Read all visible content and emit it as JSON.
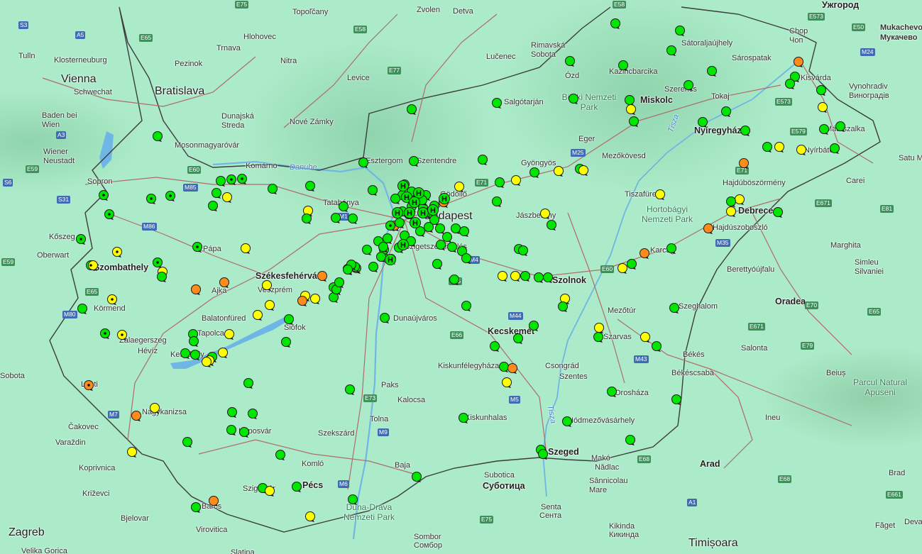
{
  "map": {
    "colors": {
      "green": "#00e600",
      "yellow": "#ffff00",
      "orange": "#ff8c1a",
      "outline": "#1a1a1a",
      "road": "#b06b6b",
      "border": "#4a4a4a",
      "water": "#6fb6e6"
    },
    "places": [
      {
        "name": "Vienna",
        "cls": "big"
      },
      {
        "name": "Bratislava",
        "cls": "big"
      },
      {
        "name": "Zagreb",
        "cls": "big"
      },
      {
        "name": "Timișoara",
        "cls": "big"
      },
      {
        "name": "Tulln",
        "cls": ""
      },
      {
        "name": "Klosterneuburg",
        "cls": ""
      },
      {
        "name": "Schwechat",
        "cls": ""
      },
      {
        "name": "Baden bei Wien",
        "cls": ""
      },
      {
        "name": "Wiener Neustadt",
        "cls": ""
      },
      {
        "name": "Oberwart",
        "cls": ""
      },
      {
        "name": "Kőszeg",
        "cls": ""
      },
      {
        "name": "Sopron",
        "cls": ""
      },
      {
        "name": "Sobota",
        "cls": ""
      },
      {
        "name": "Čakovec",
        "cls": ""
      },
      {
        "name": "Varaždin",
        "cls": ""
      },
      {
        "name": "Koprivnica",
        "cls": ""
      },
      {
        "name": "Križevci",
        "cls": ""
      },
      {
        "name": "Bjelovar",
        "cls": ""
      },
      {
        "name": "Virovitica",
        "cls": ""
      },
      {
        "name": "Velika Gorica",
        "cls": ""
      },
      {
        "name": "Pezinok",
        "cls": ""
      },
      {
        "name": "Trnava",
        "cls": ""
      },
      {
        "name": "Hlohovec",
        "cls": ""
      },
      {
        "name": "Topoľčany",
        "cls": ""
      },
      {
        "name": "Zvolen",
        "cls": ""
      },
      {
        "name": "Detva",
        "cls": ""
      },
      {
        "name": "Nitra",
        "cls": ""
      },
      {
        "name": "Levice",
        "cls": ""
      },
      {
        "name": "Lučenec",
        "cls": ""
      },
      {
        "name": "Rimavská Sobota",
        "cls": ""
      },
      {
        "name": "Dunajská Streda",
        "cls": ""
      },
      {
        "name": "Nové Zámky",
        "cls": ""
      },
      {
        "name": "Komárno",
        "cls": ""
      },
      {
        "name": "Mosonmagyaróvár",
        "cls": ""
      },
      {
        "name": "Tatabánya",
        "cls": ""
      },
      {
        "name": "Esztergom",
        "cls": ""
      },
      {
        "name": "Szentendre",
        "cls": ""
      },
      {
        "name": "Gödöllő",
        "cls": ""
      },
      {
        "name": "Budapest",
        "cls": "big"
      },
      {
        "name": "Szigetszentmiklós",
        "cls": ""
      },
      {
        "name": "Pápa",
        "cls": ""
      },
      {
        "name": "Szombathely",
        "cls": "mid"
      },
      {
        "name": "Ajka",
        "cls": ""
      },
      {
        "name": "Veszprém",
        "cls": ""
      },
      {
        "name": "Székesfehérvár",
        "cls": "mid"
      },
      {
        "name": "Balatonfüred",
        "cls": ""
      },
      {
        "name": "Siófok",
        "cls": ""
      },
      {
        "name": "Tapolca",
        "cls": ""
      },
      {
        "name": "Keszthely",
        "cls": ""
      },
      {
        "name": "Hévíz",
        "cls": ""
      },
      {
        "name": "Zalaegerszeg",
        "cls": ""
      },
      {
        "name": "Körmend",
        "cls": ""
      },
      {
        "name": "Lenti",
        "cls": ""
      },
      {
        "name": "Nagykanizsa",
        "cls": ""
      },
      {
        "name": "Kaposvár",
        "cls": ""
      },
      {
        "name": "Barcs",
        "cls": ""
      },
      {
        "name": "Szigetvár",
        "cls": ""
      },
      {
        "name": "Komló",
        "cls": ""
      },
      {
        "name": "Pécs",
        "cls": "mid"
      },
      {
        "name": "Dunaújváros",
        "cls": ""
      },
      {
        "name": "Paks",
        "cls": ""
      },
      {
        "name": "Kalocsa",
        "cls": ""
      },
      {
        "name": "Tolna",
        "cls": ""
      },
      {
        "name": "Szekszárd",
        "cls": ""
      },
      {
        "name": "Baja",
        "cls": ""
      },
      {
        "name": "Kiskunhalas",
        "cls": ""
      },
      {
        "name": "Kiskunfélegyháza",
        "cls": ""
      },
      {
        "name": "Kecskemét",
        "cls": "mid"
      },
      {
        "name": "Szeged",
        "cls": "mid"
      },
      {
        "name": "Subotica",
        "cls": ""
      },
      {
        "name": "Суботица",
        "cls": ""
      },
      {
        "name": "Senta",
        "cls": ""
      },
      {
        "name": "Сента",
        "cls": ""
      },
      {
        "name": "Sombor",
        "cls": ""
      },
      {
        "name": "Сомбор",
        "cls": ""
      },
      {
        "name": "Kikinda",
        "cls": ""
      },
      {
        "name": "Кикинда",
        "cls": ""
      },
      {
        "name": "Makó",
        "cls": ""
      },
      {
        "name": "Nădlac",
        "cls": ""
      },
      {
        "name": "Sânnicolau Mare",
        "cls": ""
      },
      {
        "name": "Hódmezővásárhely",
        "cls": ""
      },
      {
        "name": "Csongrád",
        "cls": ""
      },
      {
        "name": "Szentes",
        "cls": ""
      },
      {
        "name": "Orosháza",
        "cls": ""
      },
      {
        "name": "Szarvas",
        "cls": ""
      },
      {
        "name": "Mezőtúr",
        "cls": ""
      },
      {
        "name": "Szolnok",
        "cls": "mid"
      },
      {
        "name": "Jászberény",
        "cls": ""
      },
      {
        "name": "Gyöngyös",
        "cls": ""
      },
      {
        "name": "Eger",
        "cls": ""
      },
      {
        "name": "Mezőkövesd",
        "cls": ""
      },
      {
        "name": "Salgótarján",
        "cls": ""
      },
      {
        "name": "Ózd",
        "cls": ""
      },
      {
        "name": "Kazincbarcika",
        "cls": ""
      },
      {
        "name": "Miskolc",
        "cls": "mid"
      },
      {
        "name": "Szerencs",
        "cls": ""
      },
      {
        "name": "Tokaj",
        "cls": ""
      },
      {
        "name": "Sátoraljaújhely",
        "cls": ""
      },
      {
        "name": "Sárospatak",
        "cls": ""
      },
      {
        "name": "Kisvárda",
        "cls": ""
      },
      {
        "name": "Nyíregyháza",
        "cls": "mid"
      },
      {
        "name": "Mátészalka",
        "cls": ""
      },
      {
        "name": "Nyírbátor",
        "cls": ""
      },
      {
        "name": "Hajdúböszörmény",
        "cls": ""
      },
      {
        "name": "Debrecen",
        "cls": "mid"
      },
      {
        "name": "Hajdúszoboszló",
        "cls": ""
      },
      {
        "name": "Karcag",
        "cls": ""
      },
      {
        "name": "Tiszafüred",
        "cls": ""
      },
      {
        "name": "Berettyóújfalu",
        "cls": ""
      },
      {
        "name": "Szeghalom",
        "cls": ""
      },
      {
        "name": "Békés",
        "cls": ""
      },
      {
        "name": "Békéscsaba",
        "cls": ""
      },
      {
        "name": "Salonta",
        "cls": ""
      },
      {
        "name": "Oradea",
        "cls": "mid"
      },
      {
        "name": "Marghita",
        "cls": ""
      },
      {
        "name": "Simleu Silvaniei",
        "cls": ""
      },
      {
        "name": "Carei",
        "cls": ""
      },
      {
        "name": "Satu Mare",
        "cls": ""
      },
      {
        "name": "Ужгород",
        "cls": "mid"
      },
      {
        "name": "Mukachevo Мукачево",
        "cls": ""
      },
      {
        "name": "Chop Чоп",
        "cls": ""
      },
      {
        "name": "Vynohradiv Виноградів",
        "cls": ""
      },
      {
        "name": "Beiuș",
        "cls": ""
      },
      {
        "name": "Ineu",
        "cls": ""
      },
      {
        "name": "Arad",
        "cls": "mid"
      },
      {
        "name": "Brad",
        "cls": ""
      },
      {
        "name": "Făget",
        "cls": ""
      },
      {
        "name": "Deva",
        "cls": ""
      },
      {
        "name": "Slatina",
        "cls": ""
      },
      {
        "name": "Hlohovec",
        "cls": ""
      }
    ],
    "areas": [
      "Bükki Nemzeti Park",
      "Hortobágyi Nemzeti Park",
      "Duna-Dráva Nemzeti Park",
      "Parcul Natural Apuseni"
    ],
    "rivers": [
      "Danube",
      "Tisza",
      "Tisza"
    ],
    "shields": [
      "E75",
      "E58",
      "E77",
      "E65",
      "E58",
      "E60",
      "M85",
      "M1",
      "M86",
      "E66",
      "M7",
      "E65",
      "M9",
      "E73",
      "M6",
      "E71",
      "E75",
      "M5",
      "M44",
      "E75",
      "M4",
      "E60",
      "M35",
      "E79",
      "E671",
      "E68",
      "M43",
      "E68",
      "M3",
      "E71",
      "E573",
      "E579",
      "E573",
      "M25",
      "E50",
      "M24",
      "S3",
      "A5",
      "A3",
      "S6",
      "S31",
      "E59",
      "E59",
      "M80",
      "A1",
      "E70",
      "E671",
      "E81",
      "E65",
      "E661"
    ]
  }
}
